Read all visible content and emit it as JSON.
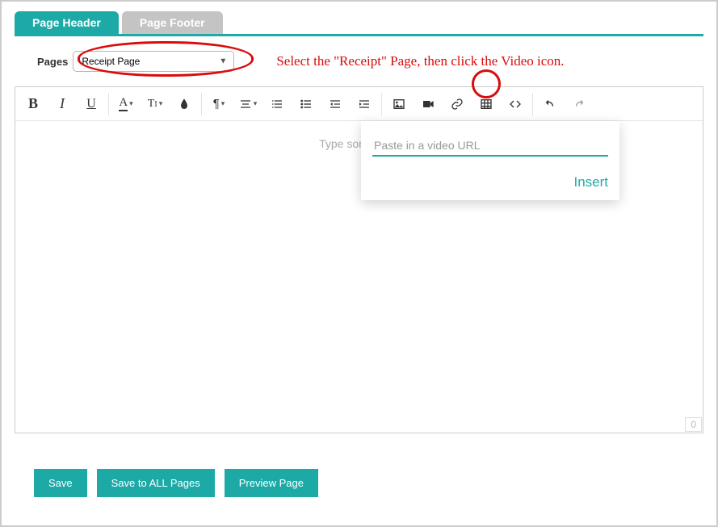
{
  "tabs": {
    "header": "Page Header",
    "footer": "Page Footer"
  },
  "pages_label": "Pages",
  "page_select_value": "Receipt Page",
  "annotation_text": "Select the \"Receipt\" Page, then click the Video icon.",
  "editor_placeholder": "Type something",
  "popup": {
    "placeholder": "Paste in a video URL",
    "insert_label": "Insert"
  },
  "char_count": "0",
  "buttons": {
    "save": "Save",
    "save_all": "Save to ALL Pages",
    "preview": "Preview Page"
  },
  "toolbar": {
    "bold": "B",
    "italic": "I",
    "underline": "U",
    "font_color": "A",
    "font_size": "TI",
    "paragraph": "¶"
  }
}
